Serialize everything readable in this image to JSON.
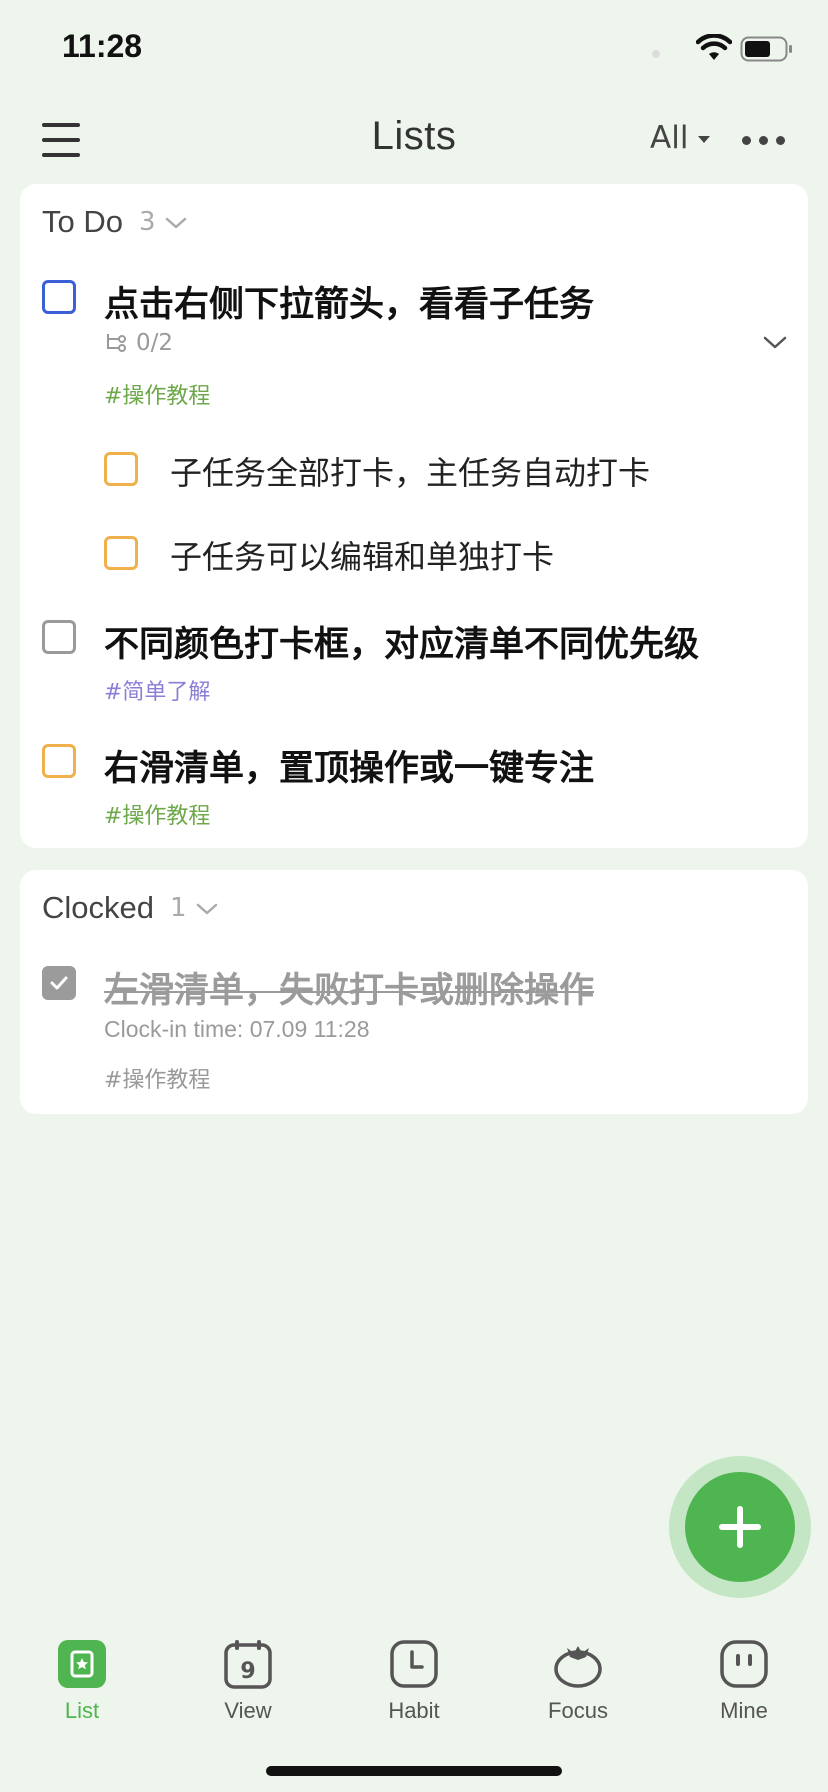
{
  "status_bar": {
    "time": "11:28"
  },
  "header": {
    "title": "Lists",
    "filter_label": "All"
  },
  "todo_section": {
    "title": "To Do",
    "count": "3",
    "tasks": [
      {
        "title": "点击右侧下拉箭头，看看子任务",
        "subtask_progress": "0/2",
        "tag": "#操作教程",
        "subtasks": [
          {
            "title": "子任务全部打卡，主任务自动打卡"
          },
          {
            "title": "子任务可以编辑和单独打卡"
          }
        ]
      },
      {
        "title": "不同颜色打卡框，对应清单不同优先级",
        "tag": "#简单了解"
      },
      {
        "title": "右滑清单，置顶操作或一键专注",
        "tag": "#操作教程"
      }
    ]
  },
  "clocked_section": {
    "title": "Clocked",
    "count": "1",
    "tasks": [
      {
        "title": "左滑清单，失败打卡或删除操作",
        "clock_in_time": "Clock-in time: 07.09 11:28",
        "tag": "#操作教程"
      }
    ]
  },
  "tabbar": {
    "tabs": [
      {
        "label": "List",
        "icon": "list-icon",
        "active": true
      },
      {
        "label": "View",
        "icon": "calendar-icon",
        "calendar_day": "9"
      },
      {
        "label": "Habit",
        "icon": "clock-icon"
      },
      {
        "label": "Focus",
        "icon": "tomato-icon"
      },
      {
        "label": "Mine",
        "icon": "profile-face-icon"
      }
    ]
  },
  "colors": {
    "accent_green": "#4fb550",
    "priority_blue": "#3a5fd6",
    "priority_orange": "#f0b04c",
    "tag_green": "#6da84a",
    "tag_purple": "#8a7fd4",
    "background": "#eef5ec"
  }
}
